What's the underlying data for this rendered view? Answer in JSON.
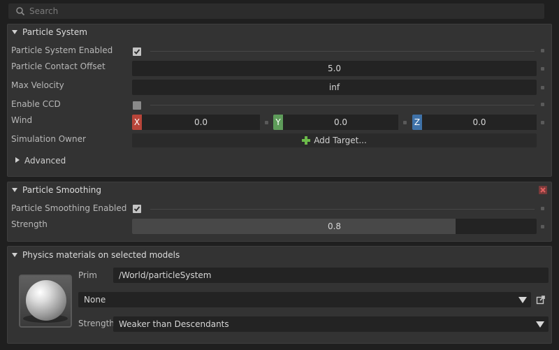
{
  "search": {
    "placeholder": "Search"
  },
  "particle_system": {
    "title": "Particle System",
    "enabled_label": "Particle System Enabled",
    "enabled": true,
    "contact_offset_label": "Particle Contact Offset",
    "contact_offset_value": "5.0",
    "max_velocity_label": "Max Velocity",
    "max_velocity_value": "inf",
    "ccd_label": "Enable CCD",
    "ccd_enabled": false,
    "wind_label": "Wind",
    "wind": {
      "x_label": "X",
      "x_value": "0.0",
      "y_label": "Y",
      "y_value": "0.0",
      "z_label": "Z",
      "z_value": "0.0"
    },
    "sim_owner_label": "Simulation Owner",
    "add_target_label": "Add Target...",
    "advanced_label": "Advanced"
  },
  "particle_smoothing": {
    "title": "Particle Smoothing",
    "enabled_label": "Particle Smoothing Enabled",
    "enabled": true,
    "strength_label": "Strength",
    "strength_value": "0.8",
    "strength_fraction": 0.8
  },
  "physics_materials": {
    "title": "Physics materials on selected models",
    "prim_label": "Prim",
    "prim_value": "/World/particleSystem",
    "material_value": "None",
    "strength_label": "Strength",
    "strength_value": "Weaker than Descendants"
  },
  "colors": {
    "axis_x": "#b8453a",
    "axis_y": "#5e9c5a",
    "axis_z": "#3f72a8",
    "add_green": "#6cba4a",
    "close_red": "#c85050"
  }
}
